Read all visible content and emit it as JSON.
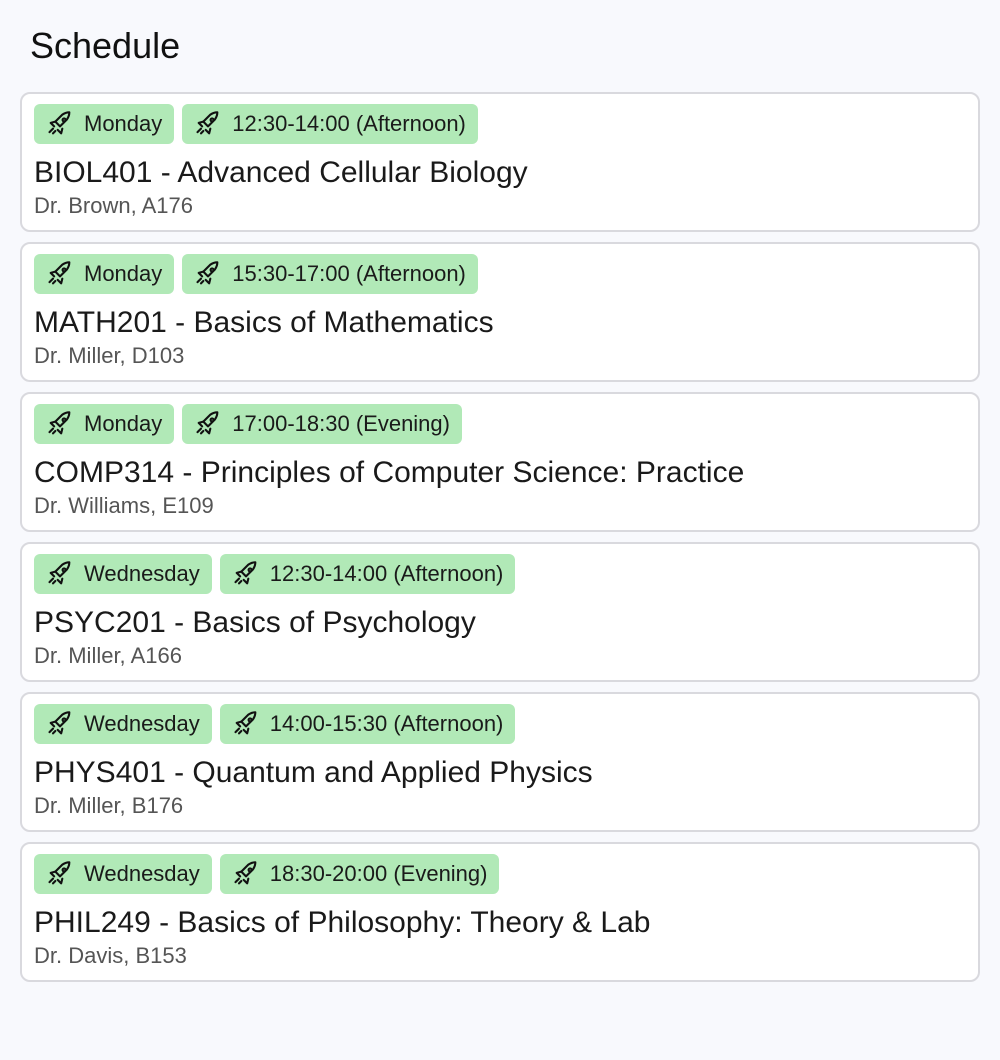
{
  "title": "Schedule",
  "icon": "rocket-icon",
  "colors": {
    "tag_bg": "#b1e9b7",
    "card_border": "#d9d9de",
    "page_bg": "#f8f9fd"
  },
  "courses": [
    {
      "day": "Monday",
      "time": "12:30-14:00 (Afternoon)",
      "title": "BIOL401 - Advanced Cellular Biology",
      "meta": "Dr. Brown, A176"
    },
    {
      "day": "Monday",
      "time": "15:30-17:00 (Afternoon)",
      "title": "MATH201 - Basics of Mathematics",
      "meta": "Dr. Miller, D103"
    },
    {
      "day": "Monday",
      "time": "17:00-18:30 (Evening)",
      "title": "COMP314 - Principles of Computer Science: Practice",
      "meta": "Dr. Williams, E109"
    },
    {
      "day": "Wednesday",
      "time": "12:30-14:00 (Afternoon)",
      "title": "PSYC201 - Basics of Psychology",
      "meta": "Dr. Miller, A166"
    },
    {
      "day": "Wednesday",
      "time": "14:00-15:30 (Afternoon)",
      "title": "PHYS401 - Quantum and Applied Physics",
      "meta": "Dr. Miller, B176"
    },
    {
      "day": "Wednesday",
      "time": "18:30-20:00 (Evening)",
      "title": "PHIL249 - Basics of Philosophy: Theory & Lab",
      "meta": "Dr. Davis, B153"
    }
  ]
}
